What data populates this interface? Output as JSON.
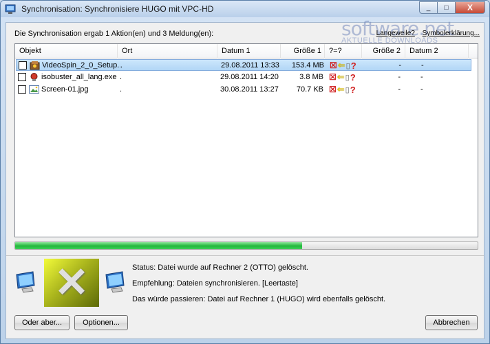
{
  "window": {
    "title": "Synchronisation: Synchronisiere HUGO mit VPC-HD",
    "min_glyph": "_",
    "max_glyph": "□",
    "close_glyph": "X"
  },
  "summary": "Die Synchronisation ergab 1 Aktion(en) und 3 Meldung(en):",
  "links": {
    "boredom": "Langeweile?",
    "legend": "Symbolerklärung..."
  },
  "watermark": {
    "brand": "software.net",
    "tagline": "AKTUELLE DOWNLOADS"
  },
  "columns": [
    "Objekt",
    "Ort",
    "Datum 1",
    "Größe 1",
    "?=?",
    "Größe 2",
    "Datum 2"
  ],
  "rows": [
    {
      "name": "VideoSpin_2_0_Setup...",
      "ort": ".",
      "datum1": "29.08.2011 13:33",
      "groesse1": "153.4 MB",
      "groesse2": "-",
      "datum2": "-",
      "icon": "setup-exe-icon",
      "selected": true
    },
    {
      "name": "isobuster_all_lang.exe",
      "ort": ".",
      "datum1": "29.08.2011 14:20",
      "groesse1": "3.8 MB",
      "groesse2": "-",
      "datum2": "-",
      "icon": "exe-icon",
      "selected": false
    },
    {
      "name": "Screen-01.jpg",
      "ort": ".",
      "datum1": "30.08.2011 13:27",
      "groesse1": "70.7 KB",
      "groesse2": "-",
      "datum2": "-",
      "icon": "image-file-icon",
      "selected": false
    }
  ],
  "progress": 0.62,
  "messages": {
    "status": "Status: Datei wurde auf Rechner 2 (OTTO) gelöscht.",
    "recommendation": "Empfehlung: Dateien synchronisieren. [Leertaste]",
    "consequence": "Das würde passieren: Datei auf Rechner 1 (HUGO) wird ebenfalls gelöscht."
  },
  "buttons": {
    "or_else": "Oder aber...",
    "options": "Optionen...",
    "cancel": "Abbrechen"
  },
  "colors": {
    "progress": "#22b73b",
    "selection": "#b1d6f6",
    "delete_x": "#d02020",
    "arrow": "#f0d000",
    "question": "#d02020"
  }
}
